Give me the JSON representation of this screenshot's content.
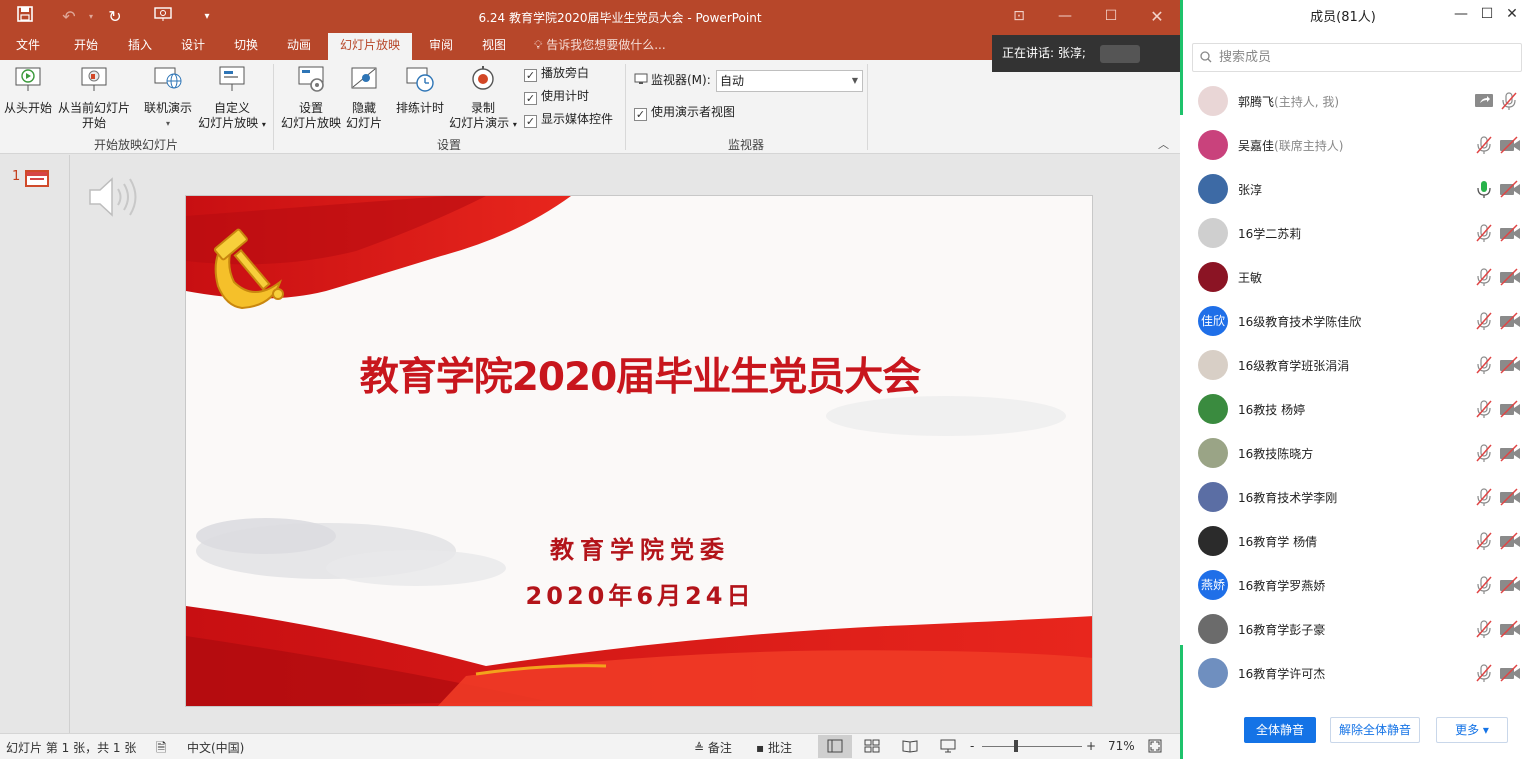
{
  "ppt": {
    "title": "6.24 教育学院2020届毕业生党员大会 - PowerPoint",
    "tabs": [
      "文件",
      "开始",
      "插入",
      "设计",
      "切换",
      "动画",
      "幻灯片放映",
      "审阅",
      "视图"
    ],
    "active_tab": "幻灯片放映",
    "tell_me": "告诉我您想要做什么...",
    "ribbon": {
      "from_beginning": "从头开始",
      "from_current_1": "从当前幻灯片",
      "from_current_2": "开始",
      "online_present": "联机演示",
      "custom_1": "自定义",
      "custom_2": "幻灯片放映",
      "group_start": "开始放映幻灯片",
      "setup_1": "设置",
      "setup_2": "幻灯片放映",
      "hide_1": "隐藏",
      "hide_2": "幻灯片",
      "rehearse": "排练计时",
      "record_1": "录制",
      "record_2": "幻灯片演示",
      "chk_narration": "播放旁白",
      "chk_timing": "使用计时",
      "chk_media": "显示媒体控件",
      "group_setup": "设置",
      "monitor_label": "监视器(M):",
      "monitor_value": "自动",
      "presenter_view": "使用演示者视图",
      "group_monitor": "监视器"
    },
    "slide_number": "1",
    "slide": {
      "title": "教育学院2020届毕业生党员大会",
      "org": "教育学院党委",
      "date": "2020年6月24日"
    },
    "status": {
      "slide_info": "幻灯片 第 1 张，共 1 张",
      "language": "中文(中国)",
      "notes": "备注",
      "comments": "批注",
      "zoom_minus": "-",
      "zoom_plus": "+",
      "zoom": "71%"
    },
    "speaking": "正在讲话: 张淳;"
  },
  "members_panel": {
    "title": "成员(81人)",
    "search_placeholder": "搜索成员",
    "members": [
      {
        "name": "郭腾飞",
        "role": "(主持人, 我)",
        "avatar_color": "#e9d6d6",
        "avatar_text": ""
      },
      {
        "name": "吴嘉佳",
        "role": "(联席主持人)",
        "avatar_color": "#c9427c",
        "avatar_text": ""
      },
      {
        "name": "张淳",
        "role": "",
        "avatar_color": "#3d6aa5",
        "avatar_text": ""
      },
      {
        "name": " 16学二苏莉",
        "role": "",
        "avatar_color": "#cfcfcf",
        "avatar_text": ""
      },
      {
        "name": " 王敏",
        "role": "",
        "avatar_color": "#8b1424",
        "avatar_text": ""
      },
      {
        "name": "16级教育技术学陈佳欣",
        "role": "",
        "avatar_color": "#1f6fe8",
        "avatar_text": "佳欣"
      },
      {
        "name": "16级教育学班张涓涓",
        "role": "",
        "avatar_color": "#d8cfc6",
        "avatar_text": ""
      },
      {
        "name": "16教技 杨婷",
        "role": "",
        "avatar_color": "#3a8b3f",
        "avatar_text": ""
      },
      {
        "name": "16教技陈晓方",
        "role": "",
        "avatar_color": "#9aa486",
        "avatar_text": ""
      },
      {
        "name": "16教育技术学李刚",
        "role": "",
        "avatar_color": "#5b6ea4",
        "avatar_text": ""
      },
      {
        "name": "16教育学 杨倩",
        "role": "",
        "avatar_color": "#2b2b2b",
        "avatar_text": ""
      },
      {
        "name": "16教育学罗燕娇",
        "role": "",
        "avatar_color": "#1f6fe8",
        "avatar_text": "燕娇"
      },
      {
        "name": "16教育学彭子豪",
        "role": "",
        "avatar_color": "#6b6b6b",
        "avatar_text": ""
      },
      {
        "name": "16教育学许可杰",
        "role": "",
        "avatar_color": "#6f8fbf",
        "avatar_text": ""
      }
    ],
    "mute_all": "全体静音",
    "unmute_all": "解除全体静音",
    "more": "更多 ▾"
  }
}
